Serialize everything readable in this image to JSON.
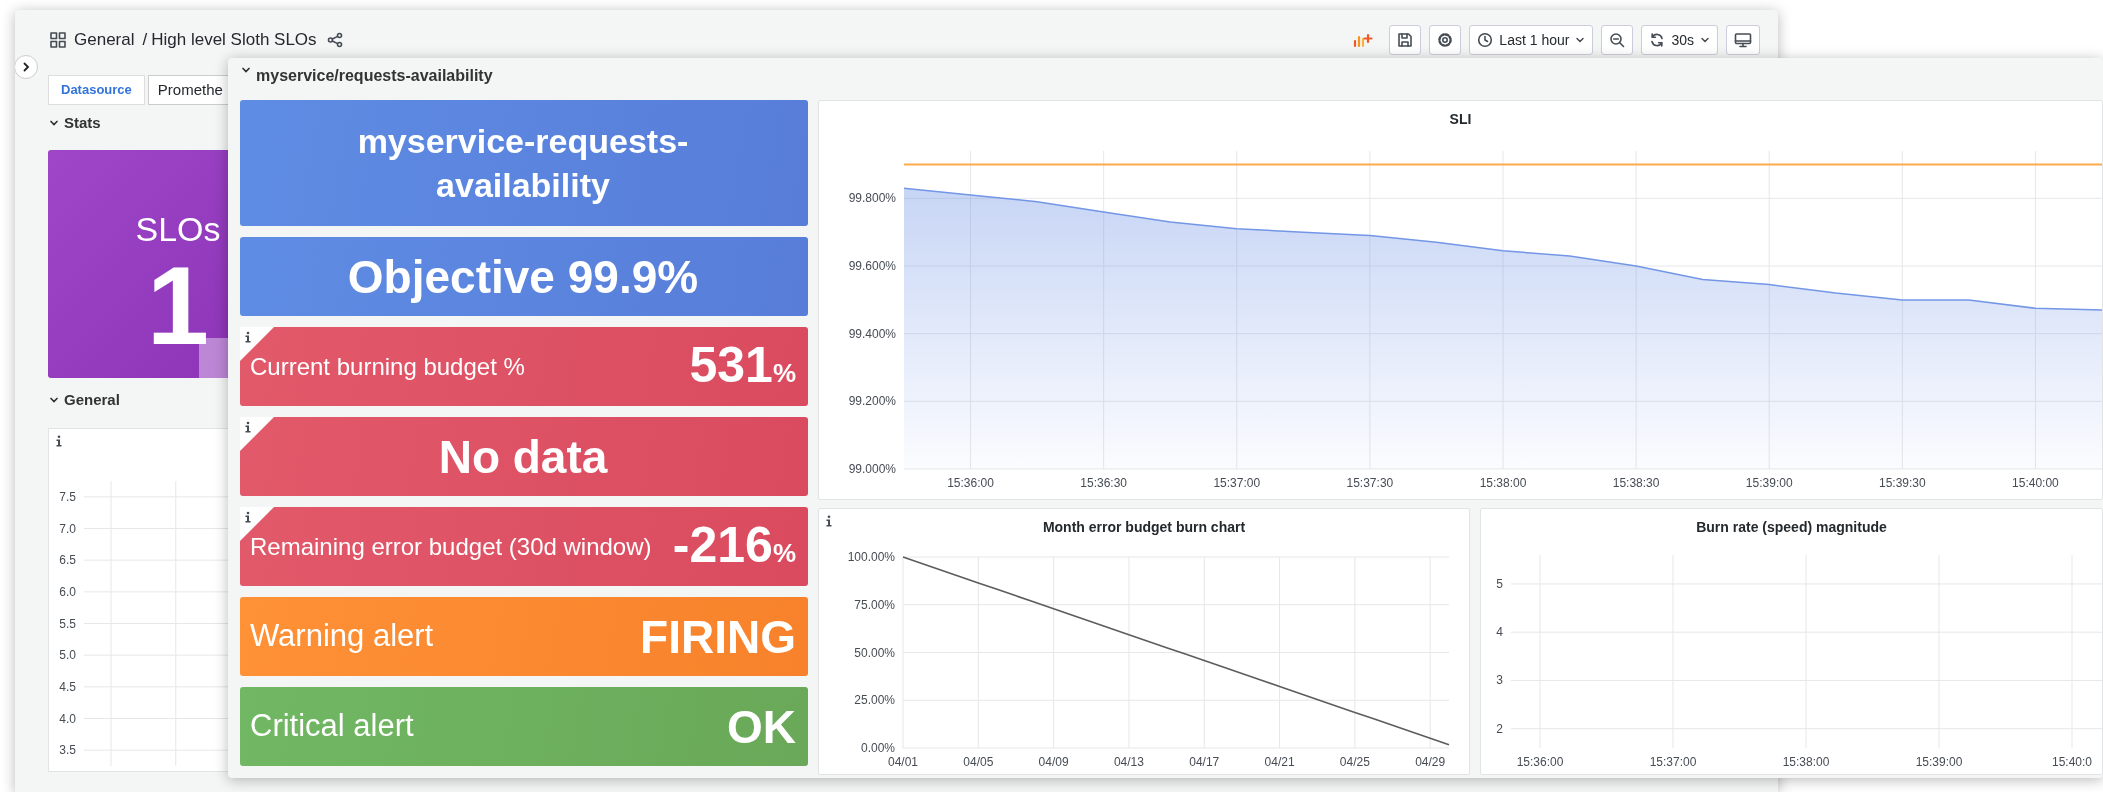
{
  "background_window": {
    "header": {
      "folder": "General",
      "separator": "/",
      "title": "High level Sloth SLOs",
      "toolbar": [
        {
          "kind": "add-panel"
        },
        {
          "kind": "save"
        },
        {
          "kind": "settings"
        },
        {
          "kind": "time-picker",
          "label": "Last 1 hour"
        },
        {
          "kind": "zoom-out"
        },
        {
          "kind": "refresh",
          "label": "30s"
        },
        {
          "kind": "tv-mode"
        }
      ]
    },
    "variables": [
      {
        "label": "Datasource",
        "value": "Promethe"
      }
    ],
    "rows": [
      {
        "title": "Stats",
        "expanded": true,
        "panels": [
          {
            "kind": "stat",
            "title": "SLOs",
            "value": "1",
            "color": "#9636c4"
          }
        ]
      },
      {
        "title": "General",
        "expanded": true,
        "panels": [
          {
            "kind": "graph",
            "info": true,
            "chart_data": {
              "type": "line",
              "grid": true,
              "ylim": [
                3.25,
                7.75
              ],
              "categories": [
                null,
                null,
                null,
                null,
                null,
                null,
                null,
                null,
                null,
                null
              ],
              "yticks": [
                {
                  "value": 3.5,
                  "label": "3.5"
                },
                {
                  "value": 4,
                  "label": "4.0"
                },
                {
                  "value": 4.5,
                  "label": "4.5"
                },
                {
                  "value": 5,
                  "label": "5.0"
                },
                {
                  "value": 5.5,
                  "label": "5.5"
                },
                {
                  "value": 6,
                  "label": "6.0"
                },
                {
                  "value": 6.5,
                  "label": "6.5"
                },
                {
                  "value": 7,
                  "label": "7.0"
                },
                {
                  "value": 7.5,
                  "label": "7.5"
                }
              ]
            }
          }
        ]
      }
    ]
  },
  "dashboard_row": {
    "title": "myservice/requests-availability",
    "expanded": true,
    "stat_panels": [
      {
        "kind": "title",
        "value": "myservice-requests-availability",
        "color": "#5585e2",
        "info": false
      },
      {
        "kind": "value",
        "value": "Objective 99.9%",
        "color": "#5585e2",
        "info": false
      },
      {
        "kind": "metric",
        "label": "Current burning budget %",
        "value": "531",
        "unit": "%",
        "color": "#e04f61",
        "info": true
      },
      {
        "kind": "value",
        "value": "No data",
        "color": "#e04f61",
        "info": true
      },
      {
        "kind": "metric",
        "label": "Remaining error budget (30d window)",
        "value": "-216",
        "unit": "%",
        "color": "#e04f61",
        "info": true
      },
      {
        "kind": "alert",
        "label": "Warning alert",
        "value": "FIRING",
        "color": "#ff8a2a",
        "info": false
      },
      {
        "kind": "alert",
        "label": "Critical alert",
        "value": "OK",
        "color": "#68b35a",
        "info": false
      }
    ],
    "graphs": [
      {
        "info": false,
        "chart_data": {
          "type": "area",
          "title": "SLI",
          "grid": true,
          "ylim": [
            99.0,
            99.94
          ],
          "categories": [
            null,
            "15:36:00",
            null,
            "15:36:30",
            null,
            "15:37:00",
            null,
            "15:37:30",
            null,
            "15:38:00",
            null,
            "15:38:30",
            null,
            "15:39:00",
            null,
            "15:39:30",
            null,
            "15:40:00",
            null
          ],
          "yticks": [
            {
              "value": 99,
              "label": "99.000%"
            },
            {
              "value": 99.2,
              "label": "99.200%"
            },
            {
              "value": 99.4,
              "label": "99.400%"
            },
            {
              "value": 99.6,
              "label": "99.600%"
            },
            {
              "value": 99.8,
              "label": "99.800%"
            }
          ],
          "series": [
            {
              "color": "#7396e6",
              "values": [
                99.83,
                99.81,
                99.79,
                99.76,
                99.73,
                99.71,
                99.7,
                99.69,
                99.67,
                99.645,
                99.63,
                99.6,
                99.56,
                99.545,
                99.52,
                99.5,
                99.5,
                99.475,
                99.47
              ]
            }
          ],
          "ref_lines": [
            {
              "axis": "y",
              "value": 99.9,
              "color": "#ffa94d"
            }
          ]
        }
      },
      {
        "info": true,
        "chart_data": {
          "type": "line",
          "title": "Month error budget burn chart",
          "grid": true,
          "ylim": [
            0,
            100
          ],
          "categories": [
            "04/01",
            null,
            null,
            null,
            "04/05",
            null,
            null,
            null,
            "04/09",
            null,
            null,
            null,
            "04/13",
            null,
            null,
            null,
            "04/17",
            null,
            null,
            null,
            "04/21",
            null,
            null,
            null,
            "04/25",
            null,
            null,
            null,
            "04/29",
            null
          ],
          "yticks": [
            {
              "value": 0,
              "label": "0.00%"
            },
            {
              "value": 25,
              "label": "25.00%"
            },
            {
              "value": 50,
              "label": "50.00%"
            },
            {
              "value": 75,
              "label": "75.00%"
            },
            {
              "value": 100,
              "label": "100.00%"
            }
          ],
          "series": [
            {
              "color": "#5c5c5c",
              "values": [
                100,
                96.6,
                93.2,
                89.8,
                86.4,
                83.1,
                79.7,
                76.3,
                72.9,
                69.5,
                66.1,
                62.7,
                59.3,
                55.9,
                52.5,
                49.2,
                45.8,
                42.4,
                39.0,
                35.6,
                32.2,
                28.8,
                25.4,
                22.0,
                18.6,
                15.3,
                11.9,
                8.5,
                5.1,
                1.7
              ]
            }
          ]
        }
      },
      {
        "info": false,
        "chart_data": {
          "type": "line",
          "title": "Burn rate (speed) magnitude",
          "grid": true,
          "ylim": [
            1.6,
            5.6
          ],
          "yticks": [
            {
              "value": 2,
              "label": "2"
            },
            {
              "value": 3,
              "label": "3"
            },
            {
              "value": 4,
              "label": "4"
            },
            {
              "value": 5,
              "label": "5"
            }
          ],
          "categories": [
            "15:36:00",
            "15:37:00",
            "15:38:00",
            "15:39:00",
            "15:40:0"
          ]
        }
      }
    ]
  }
}
